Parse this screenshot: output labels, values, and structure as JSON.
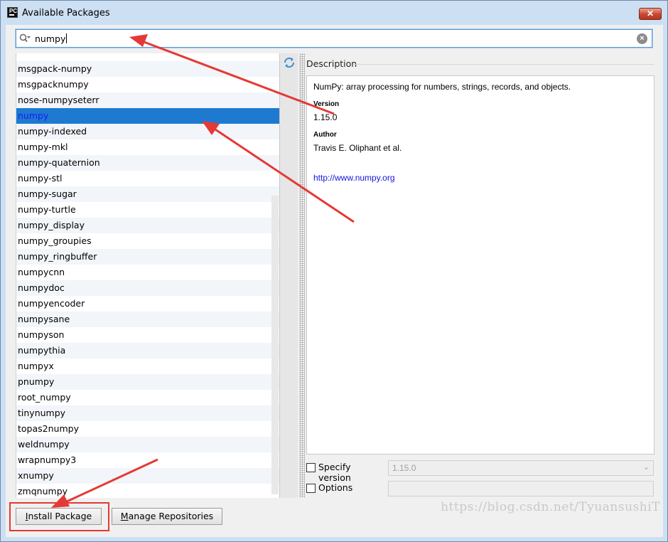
{
  "window": {
    "title": "Available Packages",
    "app_icon": "PC"
  },
  "search": {
    "value": "numpy"
  },
  "packages": [
    "msgpack-numpy",
    "msgpacknumpy",
    "nose-numpyseterr",
    "numpy",
    "numpy-indexed",
    "numpy-mkl",
    "numpy-quaternion",
    "numpy-stl",
    "numpy-sugar",
    "numpy-turtle",
    "numpy_display",
    "numpy_groupies",
    "numpy_ringbuffer",
    "numpycnn",
    "numpydoc",
    "numpyencoder",
    "numpysane",
    "numpyson",
    "numpythia",
    "numpyx",
    "pnumpy",
    "root_numpy",
    "tinynumpy",
    "topas2numpy",
    "weldnumpy",
    "wrapnumpy3",
    "xnumpy",
    "zmqnumpy"
  ],
  "selected_package": "numpy",
  "description": {
    "label": "Description",
    "summary": "NumPy: array processing for numbers, strings, records, and objects.",
    "version_label": "Version",
    "version": "1.15.0",
    "author_label": "Author",
    "author": "Travis E. Oliphant et al.",
    "url": "http://www.numpy.org"
  },
  "options": {
    "specify_version_label": "Specify version",
    "specify_version_value": "1.15.0",
    "options_label": "Options"
  },
  "buttons": {
    "install_u": "I",
    "install_rest": "nstall Package",
    "manage_u": "M",
    "manage_rest": "anage Repositories"
  },
  "watermark": "https://blog.csdn.net/TyuansushiT",
  "colors": {
    "selection": "#1e7ad0",
    "annotation": "#e53935",
    "link": "#1515d6"
  }
}
